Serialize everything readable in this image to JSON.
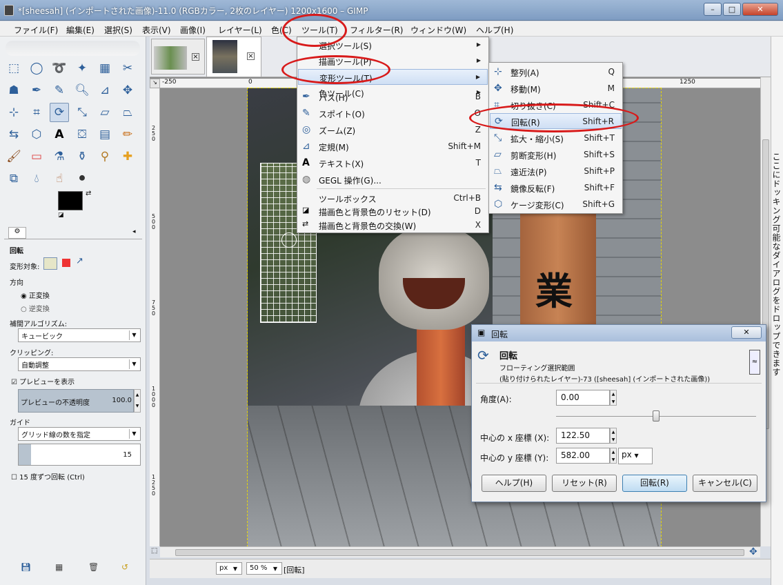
{
  "window": {
    "title": "*[sheesah] (インポートされた画像)-11.0 (RGBカラー, 2枚のレイヤー) 1200x1600 – GIMP"
  },
  "menubar": [
    "ファイル(F)",
    "編集(E)",
    "選択(S)",
    "表示(V)",
    "画像(I)",
    "レイヤー(L)",
    "色(C)",
    "ツール(T)",
    "フィルター(R)",
    "ウィンドウ(W)",
    "ヘルプ(H)"
  ],
  "toolbox": {
    "tool_options_title": "回転",
    "transform_label": "変形対象:",
    "direction_label": "方向",
    "direction_options": [
      "正変換",
      "逆変換"
    ],
    "interp_label": "補間アルゴリズム:",
    "interp_value": "キュービック",
    "clip_label": "クリッピング:",
    "clip_value": "自動調整",
    "preview_label": "プレビューを表示",
    "opacity_label": "プレビューの不透明度",
    "opacity_value": "100.0",
    "guide_label": "ガイド",
    "guide_value": "グリッド線の数を指定",
    "grid_count": "15",
    "snap_label": "15 度ずつ回転 (Ctrl)"
  },
  "ruler": {
    "h": [
      "-250",
      "0",
      "1250"
    ],
    "v": [
      "2\n5\n0",
      "5\n0\n0",
      "7\n5\n0",
      "1\n0\n0\n0",
      "1\n2\n5\n0"
    ]
  },
  "tools_menu": {
    "items": [
      {
        "label": "選択ツール(S)",
        "shortcut": "",
        "submenu": true
      },
      {
        "label": "描画ツール(P)",
        "shortcut": "",
        "submenu": true
      },
      {
        "label": "変形ツール(T)",
        "shortcut": "",
        "submenu": true
      },
      {
        "label": "色ツール(C)",
        "shortcut": "",
        "submenu": true
      },
      {
        "label": "パス(H)",
        "shortcut": "B"
      },
      {
        "label": "スポイト(O)",
        "shortcut": "O"
      },
      {
        "label": "ズーム(Z)",
        "shortcut": "Z"
      },
      {
        "label": "定規(M)",
        "shortcut": "Shift+M"
      },
      {
        "label": "テキスト(X)",
        "shortcut": "T"
      },
      {
        "label": "GEGL 操作(G)...",
        "shortcut": ""
      },
      {
        "label": "ツールボックス",
        "shortcut": "Ctrl+B"
      },
      {
        "label": "描画色と背景色のリセット(D)",
        "shortcut": "D"
      },
      {
        "label": "描画色と背景色の交換(W)",
        "shortcut": "X"
      }
    ]
  },
  "transform_menu": {
    "items": [
      {
        "label": "整列(A)",
        "shortcut": "Q"
      },
      {
        "label": "移動(M)",
        "shortcut": "M"
      },
      {
        "label": "切り抜き(C)",
        "shortcut": "Shift+C"
      },
      {
        "label": "回転(R)",
        "shortcut": "Shift+R"
      },
      {
        "label": "拡大・縮小(S)",
        "shortcut": "Shift+T"
      },
      {
        "label": "剪断変形(H)",
        "shortcut": "Shift+S"
      },
      {
        "label": "遠近法(P)",
        "shortcut": "Shift+P"
      },
      {
        "label": "鏡像反転(F)",
        "shortcut": "Shift+F"
      },
      {
        "label": "ケージ変形(C)",
        "shortcut": "Shift+G"
      }
    ]
  },
  "rotate_dialog": {
    "title": "回転",
    "header": "回転",
    "sub1": "フローティング選択範囲",
    "sub2": "(貼り付けられたレイヤー)-73 ([sheesah] (インポートされた画像))",
    "angle_label": "角度(A):",
    "angle_value": "0.00",
    "cx_label": "中心の x 座標 (X):",
    "cx_value": "122.50",
    "cy_label": "中心の y 座標 (Y):",
    "cy_value": "582.00",
    "unit": "px",
    "buttons": [
      "ヘルプ(H)",
      "リセット(R)",
      "回転(R)",
      "キャンセル(C)"
    ]
  },
  "sign_text": "業",
  "right_dock_text": "ここにドッキング可能なダイアログをドロップできます",
  "statusbar": {
    "unit": "px",
    "zoom": "50 %",
    "message": "[回転]"
  }
}
